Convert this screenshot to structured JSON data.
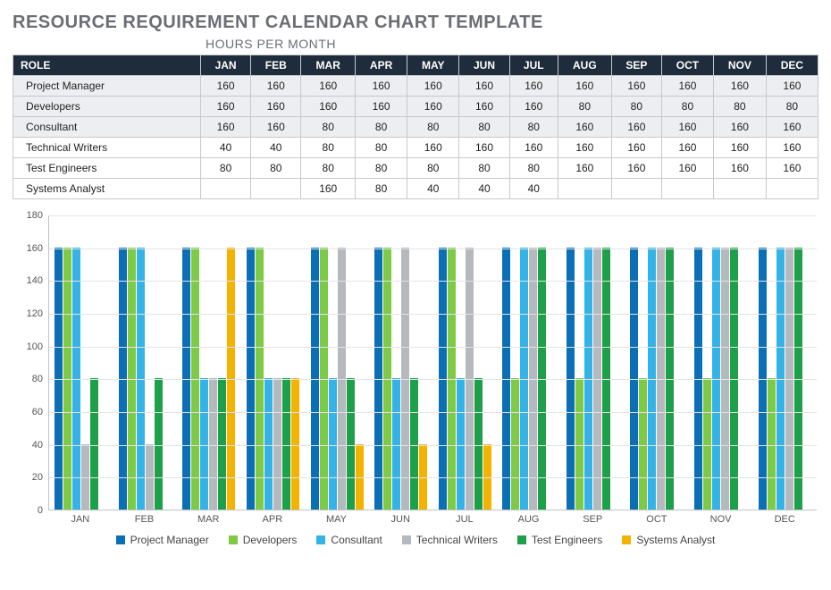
{
  "title": "RESOURCE REQUIREMENT CALENDAR CHART TEMPLATE",
  "subtitle": "HOURS PER MONTH",
  "table": {
    "role_header": "ROLE",
    "months": [
      "JAN",
      "FEB",
      "MAR",
      "APR",
      "MAY",
      "JUN",
      "JUL",
      "AUG",
      "SEP",
      "OCT",
      "NOV",
      "DEC"
    ],
    "rows": [
      {
        "role": "Project Manager",
        "shaded": true,
        "values": [
          160,
          160,
          160,
          160,
          160,
          160,
          160,
          160,
          160,
          160,
          160,
          160
        ]
      },
      {
        "role": "Developers",
        "shaded": true,
        "values": [
          160,
          160,
          160,
          160,
          160,
          160,
          160,
          80,
          80,
          80,
          80,
          80
        ]
      },
      {
        "role": "Consultant",
        "shaded": true,
        "values": [
          160,
          160,
          80,
          80,
          80,
          80,
          80,
          160,
          160,
          160,
          160,
          160
        ]
      },
      {
        "role": "Technical Writers",
        "shaded": false,
        "values": [
          40,
          40,
          80,
          80,
          160,
          160,
          160,
          160,
          160,
          160,
          160,
          160
        ]
      },
      {
        "role": "Test Engineers",
        "shaded": false,
        "values": [
          80,
          80,
          80,
          80,
          80,
          80,
          80,
          160,
          160,
          160,
          160,
          160
        ]
      },
      {
        "role": "Systems Analyst",
        "shaded": false,
        "values": [
          null,
          null,
          160,
          80,
          40,
          40,
          40,
          null,
          null,
          null,
          null,
          null
        ]
      }
    ]
  },
  "chart_data": {
    "type": "bar",
    "title": "",
    "xlabel": "",
    "ylabel": "",
    "ylim": [
      0,
      180
    ],
    "yticks": [
      0,
      20,
      40,
      60,
      80,
      100,
      120,
      140,
      160,
      180
    ],
    "categories": [
      "JAN",
      "FEB",
      "MAR",
      "APR",
      "MAY",
      "JUN",
      "JUL",
      "AUG",
      "SEP",
      "OCT",
      "NOV",
      "DEC"
    ],
    "series": [
      {
        "name": "Project Manager",
        "color": "#0a6fb5",
        "values": [
          160,
          160,
          160,
          160,
          160,
          160,
          160,
          160,
          160,
          160,
          160,
          160
        ]
      },
      {
        "name": "Developers",
        "color": "#7ec946",
        "values": [
          160,
          160,
          160,
          160,
          160,
          160,
          160,
          80,
          80,
          80,
          80,
          80
        ]
      },
      {
        "name": "Consultant",
        "color": "#33b3e6",
        "values": [
          160,
          160,
          80,
          80,
          80,
          80,
          80,
          160,
          160,
          160,
          160,
          160
        ]
      },
      {
        "name": "Technical Writers",
        "color": "#b5b8bc",
        "values": [
          40,
          40,
          80,
          80,
          160,
          160,
          160,
          160,
          160,
          160,
          160,
          160
        ]
      },
      {
        "name": "Test Engineers",
        "color": "#1ea04a",
        "values": [
          80,
          80,
          80,
          80,
          80,
          80,
          80,
          160,
          160,
          160,
          160,
          160
        ]
      },
      {
        "name": "Systems Analyst",
        "color": "#f3b300",
        "values": [
          null,
          null,
          160,
          80,
          40,
          40,
          40,
          null,
          null,
          null,
          null,
          null
        ]
      }
    ]
  }
}
